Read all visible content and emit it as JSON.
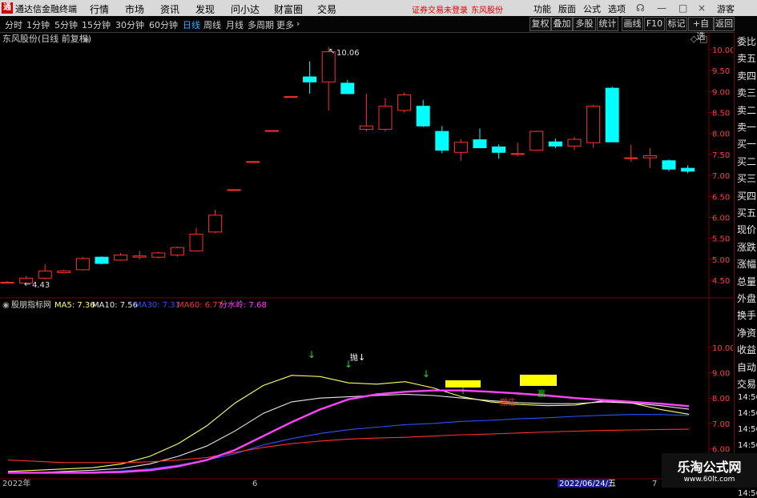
{
  "app": {
    "logo": "通",
    "title": "通达信金融终端",
    "menu": [
      "行情",
      "市场",
      "资讯",
      "发现",
      "问小达",
      "财富圈",
      "交易"
    ],
    "notice": "证券交易未登录",
    "stock_name": "东风股份",
    "right_menu": [
      "功能",
      "版面",
      "公式",
      "选项"
    ],
    "guest": "游客"
  },
  "toolbar": {
    "periods": [
      "分时",
      "1分钟",
      "5分钟",
      "15分钟",
      "30分钟",
      "60分钟",
      "日线",
      "周线",
      "月线",
      "多周期",
      "更多"
    ],
    "active_period": "日线",
    "right_buttons": [
      "复权",
      "叠加",
      "多股",
      "统计",
      "画线",
      "F10",
      "标记",
      "+自选",
      "返回"
    ]
  },
  "main_chart": {
    "title": "东风股份(日线 前复权)",
    "high_label": "10.06",
    "low_label": "4.43",
    "y_ticks": [
      "10.00",
      "9.50",
      "9.00",
      "8.50",
      "8.00",
      "7.50",
      "7.00",
      "6.50",
      "6.00",
      "5.50",
      "5.00",
      "4.50"
    ]
  },
  "indicator": {
    "name": "股朋指标网",
    "legend": [
      {
        "text": "MA5: 7.36",
        "color": "#ffff66"
      },
      {
        "text": "MA10: 7.56",
        "color": "#e8e8e8"
      },
      {
        "text": "MA30: 7.31",
        "color": "#3050ff"
      },
      {
        "text": "MA60: 6.77",
        "color": "#ff3030"
      },
      {
        "text": "分水岭: 7.68",
        "color": "#ff44ff"
      }
    ],
    "y_ticks": [
      "10.00",
      "9.00",
      "8.00",
      "7.00",
      "6.00"
    ],
    "sell_label": "抛",
    "zhuang_label": "撤庄",
    "win_label": "赢"
  },
  "xaxis": {
    "labels": [
      "2022年",
      "6",
      "2022/06/24/五",
      "7"
    ]
  },
  "right_panel": {
    "header": "委比",
    "items": [
      "委比",
      "卖五",
      "卖四",
      "卖三",
      "卖二",
      "卖一",
      "买一",
      "买二",
      "买三",
      "买四",
      "买五",
      "现价",
      "涨跌",
      "涨幅",
      "总量",
      "外盘",
      "换手",
      "净资",
      "收益",
      "自动",
      "交易"
    ],
    "times": [
      "14:56",
      "14:56",
      "14:56",
      "14:56",
      "14:56",
      "14:56",
      "14:56"
    ]
  },
  "colors": {
    "up": "#ff3030",
    "down": "#00ffff",
    "frame": "#7a0000"
  },
  "watermark": {
    "line1": "乐淘公式网",
    "line2": "www.60lt.com"
  },
  "chart_data": {
    "type": "candlestick",
    "title": "东风股份(日线 前复权)",
    "ylim": [
      4.3,
      10.3
    ],
    "candles": [
      {
        "o": 4.45,
        "h": 4.48,
        "l": 4.43,
        "c": 4.45
      },
      {
        "o": 4.43,
        "h": 4.6,
        "l": 4.43,
        "c": 4.55
      },
      {
        "o": 4.55,
        "h": 4.88,
        "l": 4.52,
        "c": 4.72
      },
      {
        "o": 4.68,
        "h": 4.75,
        "l": 4.66,
        "c": 4.72
      },
      {
        "o": 4.75,
        "h": 5.05,
        "l": 4.73,
        "c": 5.02
      },
      {
        "o": 5.05,
        "h": 5.07,
        "l": 4.88,
        "c": 4.9
      },
      {
        "o": 4.98,
        "h": 5.15,
        "l": 4.96,
        "c": 5.1
      },
      {
        "o": 5.05,
        "h": 5.2,
        "l": 5.0,
        "c": 5.08
      },
      {
        "o": 5.05,
        "h": 5.18,
        "l": 5.02,
        "c": 5.15
      },
      {
        "o": 5.1,
        "h": 5.3,
        "l": 5.06,
        "c": 5.28
      },
      {
        "o": 5.2,
        "h": 5.75,
        "l": 5.18,
        "c": 5.6
      },
      {
        "o": 5.65,
        "h": 6.18,
        "l": 5.62,
        "c": 6.05
      },
      {
        "o": 6.66,
        "h": 6.66,
        "l": 6.66,
        "c": 6.66
      },
      {
        "o": 7.33,
        "h": 7.33,
        "l": 7.33,
        "c": 7.33
      },
      {
        "o": 8.07,
        "h": 8.07,
        "l": 8.07,
        "c": 8.07
      },
      {
        "o": 8.88,
        "h": 8.88,
        "l": 8.88,
        "c": 8.88
      },
      {
        "o": 9.35,
        "h": 9.72,
        "l": 8.95,
        "c": 9.23
      },
      {
        "o": 9.23,
        "h": 10.06,
        "l": 8.55,
        "c": 9.95
      },
      {
        "o": 9.2,
        "h": 9.28,
        "l": 8.95,
        "c": 8.95
      },
      {
        "o": 8.1,
        "h": 8.95,
        "l": 8.05,
        "c": 8.18
      },
      {
        "o": 8.1,
        "h": 8.85,
        "l": 8.05,
        "c": 8.65
      },
      {
        "o": 8.55,
        "h": 8.98,
        "l": 8.5,
        "c": 8.92
      },
      {
        "o": 8.65,
        "h": 8.8,
        "l": 8.15,
        "c": 8.18
      },
      {
        "o": 8.05,
        "h": 8.18,
        "l": 7.53,
        "c": 7.6
      },
      {
        "o": 7.55,
        "h": 7.86,
        "l": 7.35,
        "c": 7.79
      },
      {
        "o": 7.85,
        "h": 8.12,
        "l": 7.66,
        "c": 7.66
      },
      {
        "o": 7.68,
        "h": 7.74,
        "l": 7.4,
        "c": 7.55
      },
      {
        "o": 7.52,
        "h": 7.78,
        "l": 7.45,
        "c": 7.52
      },
      {
        "o": 7.6,
        "h": 8.07,
        "l": 7.58,
        "c": 8.05
      },
      {
        "o": 7.8,
        "h": 7.88,
        "l": 7.65,
        "c": 7.7
      },
      {
        "o": 7.7,
        "h": 7.92,
        "l": 7.6,
        "c": 7.86
      },
      {
        "o": 7.78,
        "h": 8.68,
        "l": 7.66,
        "c": 8.65
      },
      {
        "o": 9.08,
        "h": 9.12,
        "l": 7.8,
        "c": 7.8
      },
      {
        "o": 7.42,
        "h": 7.73,
        "l": 7.32,
        "c": 7.42
      },
      {
        "o": 7.42,
        "h": 7.65,
        "l": 7.18,
        "c": 7.47
      },
      {
        "o": 7.35,
        "h": 7.38,
        "l": 7.1,
        "c": 7.15
      },
      {
        "o": 7.17,
        "h": 7.24,
        "l": 7.05,
        "c": 7.1
      }
    ],
    "indicator_ylim": [
      5.0,
      10.5
    ],
    "indicator_series": [
      {
        "name": "MA5",
        "color": "#ffff66",
        "values": [
          5.1,
          5.15,
          5.2,
          5.25,
          5.4,
          5.7,
          6.2,
          6.9,
          7.8,
          8.5,
          8.9,
          8.85,
          8.6,
          8.55,
          8.65,
          8.4,
          8.05,
          7.85,
          7.75,
          7.7,
          7.72,
          7.9,
          7.8,
          7.55,
          7.36
        ]
      },
      {
        "name": "MA10",
        "color": "#e8e8e8",
        "values": [
          5.05,
          5.05,
          5.1,
          5.15,
          5.22,
          5.4,
          5.7,
          6.1,
          6.7,
          7.4,
          7.85,
          8.0,
          8.05,
          8.1,
          8.15,
          8.1,
          8.0,
          7.9,
          7.82,
          7.78,
          7.78,
          7.85,
          7.8,
          7.7,
          7.56
        ]
      },
      {
        "name": "MA30",
        "color": "#3050ff",
        "values": [
          5.05,
          5.05,
          5.05,
          5.08,
          5.12,
          5.2,
          5.35,
          5.55,
          5.8,
          6.15,
          6.4,
          6.6,
          6.75,
          6.85,
          6.95,
          7.0,
          7.08,
          7.12,
          7.18,
          7.22,
          7.28,
          7.32,
          7.35,
          7.35,
          7.31
        ]
      },
      {
        "name": "MA60",
        "color": "#ff3030",
        "values": [
          5.55,
          5.5,
          5.45,
          5.45,
          5.45,
          5.48,
          5.55,
          5.65,
          5.85,
          6.05,
          6.2,
          6.3,
          6.38,
          6.42,
          6.45,
          6.5,
          6.55,
          6.58,
          6.62,
          6.66,
          6.69,
          6.72,
          6.74,
          6.76,
          6.77
        ]
      },
      {
        "name": "分水岭",
        "color": "#ff44ff",
        "values": [
          5.05,
          5.05,
          5.05,
          5.05,
          5.08,
          5.15,
          5.3,
          5.55,
          5.95,
          6.5,
          7.05,
          7.55,
          7.95,
          8.15,
          8.25,
          8.3,
          8.3,
          8.25,
          8.18,
          8.1,
          8.0,
          7.92,
          7.85,
          7.78,
          7.68
        ]
      }
    ]
  }
}
